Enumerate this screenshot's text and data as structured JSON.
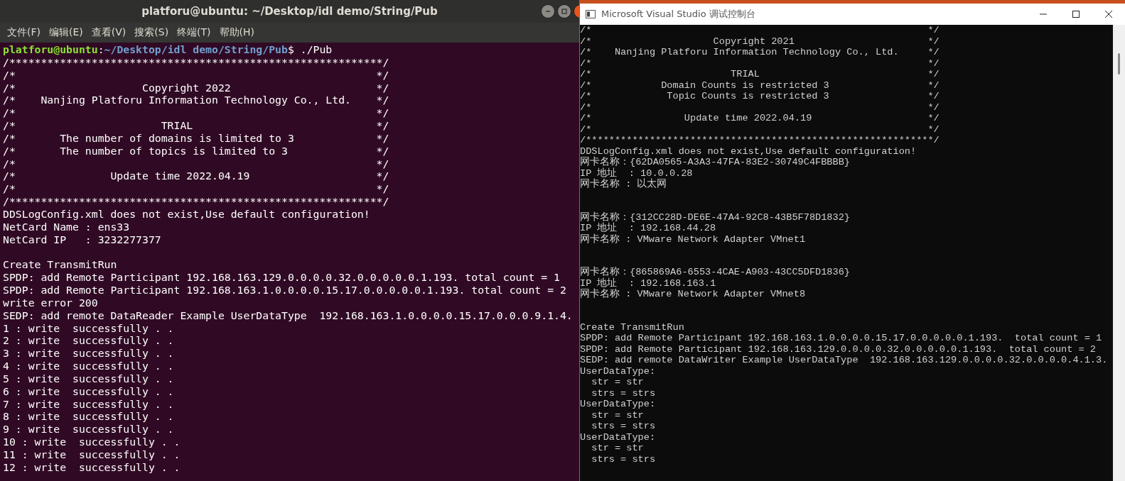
{
  "terminal": {
    "title": "platforu@ubuntu: ~/Desktop/idl demo/String/Pub",
    "menu": [
      "文件(F)",
      "编辑(E)",
      "查看(V)",
      "搜索(S)",
      "终端(T)",
      "帮助(H)"
    ],
    "lines": [
      {
        "kind": "prompt",
        "user": "platforu@ubuntu",
        "separator": ":",
        "path": "~/Desktop/idl demo/String/Pub",
        "command": "$ ./Pub"
      },
      {
        "kind": "text",
        "text": "/***********************************************************/"
      },
      {
        "kind": "text",
        "text": "/*                                                         */"
      },
      {
        "kind": "text",
        "text": "/*                    Copyright 2022                       */"
      },
      {
        "kind": "text",
        "text": "/*    Nanjing Platforu Information Technology Co., Ltd.    */"
      },
      {
        "kind": "text",
        "text": "/*                                                         */"
      },
      {
        "kind": "text",
        "text": "/*                       TRIAL                             */"
      },
      {
        "kind": "text",
        "text": "/*       The number of domains is limited to 3             */"
      },
      {
        "kind": "text",
        "text": "/*       The number of topics is limited to 3              */"
      },
      {
        "kind": "text",
        "text": "/*                                                         */"
      },
      {
        "kind": "text",
        "text": "/*               Update time 2022.04.19                    */"
      },
      {
        "kind": "text",
        "text": "/*                                                         */"
      },
      {
        "kind": "text",
        "text": "/***********************************************************/"
      },
      {
        "kind": "text",
        "text": "DDSLogConfig.xml does not exist,Use default configuration!"
      },
      {
        "kind": "text",
        "text": "NetCard Name : ens33"
      },
      {
        "kind": "text",
        "text": "NetCard IP   : 3232277377"
      },
      {
        "kind": "blank"
      },
      {
        "kind": "text",
        "text": "Create TransmitRun"
      },
      {
        "kind": "text",
        "text": "SPDP: add Remote Participant 192.168.163.129.0.0.0.0.32.0.0.0.0.0.1.193. total count = 1"
      },
      {
        "kind": "text",
        "text": "SPDP: add Remote Participant 192.168.163.1.0.0.0.0.15.17.0.0.0.0.0.1.193. total count = 2"
      },
      {
        "kind": "text",
        "text": "write error 200"
      },
      {
        "kind": "text",
        "text": "SEDP: add remote DataReader Example UserDataType  192.168.163.1.0.0.0.0.15.17.0.0.0.9.1.4."
      },
      {
        "kind": "text",
        "text": "1 : write  successfully . ."
      },
      {
        "kind": "text",
        "text": "2 : write  successfully . ."
      },
      {
        "kind": "text",
        "text": "3 : write  successfully . ."
      },
      {
        "kind": "text",
        "text": "4 : write  successfully . ."
      },
      {
        "kind": "text",
        "text": "5 : write  successfully . ."
      },
      {
        "kind": "text",
        "text": "6 : write  successfully . ."
      },
      {
        "kind": "text",
        "text": "7 : write  successfully . ."
      },
      {
        "kind": "text",
        "text": "8 : write  successfully . ."
      },
      {
        "kind": "text",
        "text": "9 : write  successfully . ."
      },
      {
        "kind": "text",
        "text": "10 : write  successfully . ."
      },
      {
        "kind": "text",
        "text": "11 : write  successfully . ."
      },
      {
        "kind": "text",
        "text": "12 : write  successfully . ."
      }
    ]
  },
  "console": {
    "title": "Microsoft Visual Studio 调试控制台",
    "lines": [
      {
        "kind": "text",
        "text": "/*                                                          */"
      },
      {
        "kind": "text",
        "text": "/*                     Copyright 2021                       */"
      },
      {
        "kind": "text",
        "text": "/*    Nanjing Platforu Information Technology Co., Ltd.     */"
      },
      {
        "kind": "text",
        "text": "/*                                                          */"
      },
      {
        "kind": "text",
        "text": "/*                        TRIAL                             */"
      },
      {
        "kind": "text",
        "text": "/*            Domain Counts is restricted 3                 */"
      },
      {
        "kind": "text",
        "text": "/*             Topic Counts is restricted 3                 */"
      },
      {
        "kind": "text",
        "text": "/*                                                          */"
      },
      {
        "kind": "text",
        "text": "/*                Update time 2022.04.19                    */"
      },
      {
        "kind": "text",
        "text": "/*                                                          */"
      },
      {
        "kind": "text",
        "text": "/************************************************************/"
      },
      {
        "kind": "text",
        "text": "DDSLogConfig.xml does not exist,Use default configuration!"
      },
      {
        "kind": "text",
        "text": "网卡名称：{62DA0565-A3A3-47FA-83E2-30749C4FBBBB}"
      },
      {
        "kind": "text",
        "text": "IP 地址  : 10.0.0.28"
      },
      {
        "kind": "text",
        "text": "网卡名称 : 以太网"
      },
      {
        "kind": "blank"
      },
      {
        "kind": "blank"
      },
      {
        "kind": "text",
        "text": "网卡名称：{312CC28D-DE6E-47A4-92C8-43B5F78D1832}"
      },
      {
        "kind": "text",
        "text": "IP 地址  : 192.168.44.28"
      },
      {
        "kind": "text",
        "text": "网卡名称 : VMware Network Adapter VMnet1"
      },
      {
        "kind": "blank"
      },
      {
        "kind": "blank"
      },
      {
        "kind": "text",
        "text": "网卡名称：{865869A6-6553-4CAE-A903-43CC5DFD1836}"
      },
      {
        "kind": "text",
        "text": "IP 地址  : 192.168.163.1"
      },
      {
        "kind": "text",
        "text": "网卡名称 : VMware Network Adapter VMnet8"
      },
      {
        "kind": "blank"
      },
      {
        "kind": "blank"
      },
      {
        "kind": "text",
        "text": "Create TransmitRun"
      },
      {
        "kind": "text",
        "text": "SPDP: add Remote Participant 192.168.163.1.0.0.0.0.15.17.0.0.0.0.0.1.193.  total count = 1"
      },
      {
        "kind": "text",
        "text": "SPDP: add Remote Participant 192.168.163.129.0.0.0.0.32.0.0.0.0.0.1.193.  total count = 2"
      },
      {
        "kind": "text",
        "text": "SEDP: add remote DataWriter Example UserDataType  192.168.163.129.0.0.0.0.32.0.0.0.0.4.1.3."
      },
      {
        "kind": "text",
        "text": "UserDataType:"
      },
      {
        "kind": "text",
        "text": "  str = str"
      },
      {
        "kind": "text",
        "text": "  strs = strs"
      },
      {
        "kind": "text",
        "text": "UserDataType:"
      },
      {
        "kind": "text",
        "text": "  str = str"
      },
      {
        "kind": "text",
        "text": "  strs = strs"
      },
      {
        "kind": "text",
        "text": "UserDataType:"
      },
      {
        "kind": "text",
        "text": "  str = str"
      },
      {
        "kind": "text",
        "text": "  strs = strs"
      }
    ]
  }
}
